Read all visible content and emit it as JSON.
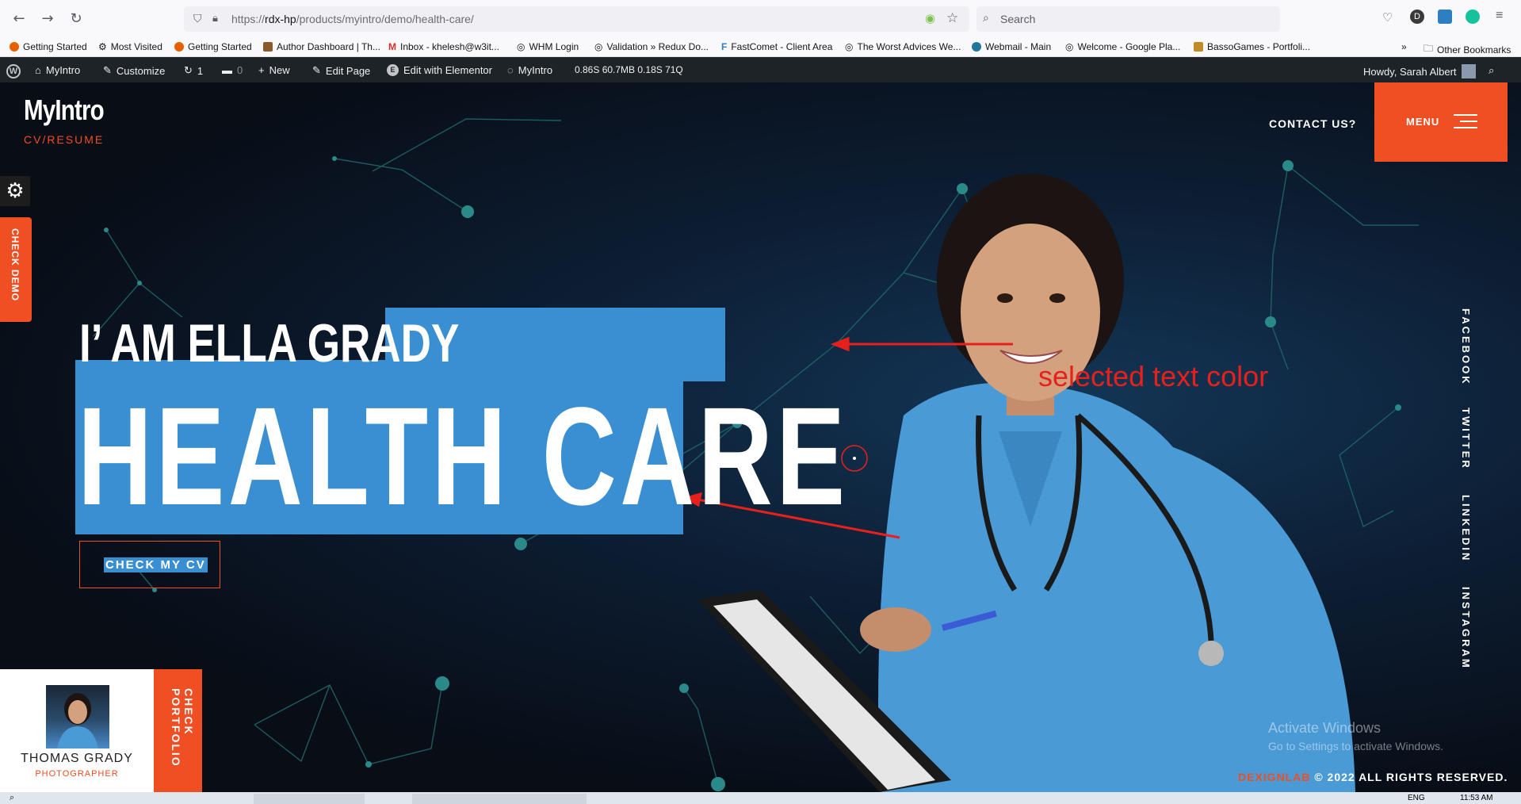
{
  "browser": {
    "url_prefix": "https://",
    "url_host": "rdx-hp",
    "url_path": "/products/myintro/demo/health-care/",
    "search_placeholder": "Search",
    "bookmarks": [
      "Getting Started",
      "Most Visited",
      "Getting Started",
      "Author Dashboard | Th...",
      "Inbox - khelesh@w3it...",
      "WHM Login",
      "Validation » Redux Do...",
      "FastComet - Client Area",
      "The Worst Advices We...",
      "Webmail - Main",
      "Welcome - Google Pla...",
      "BassoGames - Portfoli..."
    ],
    "other_bookmarks": "Other Bookmarks",
    "profile_initial": "D"
  },
  "wp_admin": {
    "site": "MyIntro",
    "customize": "Customize",
    "updates": "1",
    "comments": "0",
    "new": "New",
    "edit_page": "Edit Page",
    "edit_elementor": "Edit with Elementor",
    "theme": "MyIntro",
    "stats": "0.86S 60.7MB 0.18S 71Q",
    "howdy": "Howdy, Sarah Albert"
  },
  "site": {
    "logo_title": "MyIntro",
    "logo_subtitle": "CV/RESUME",
    "contact": "CONTACT US?",
    "menu": "MENU",
    "check_demo": "CHECK DEMO",
    "hero_subtitle": "I’ AM ELLA GRADY",
    "hero_title": "HEALTH CARE",
    "cv_button": "CHECK MY CV",
    "annotation": "selected text color",
    "social": [
      "FACEBOOK",
      "TWITTER",
      "LINKEDIN",
      "INSTAGRAM"
    ],
    "profile_name": "THOMAS GRADY",
    "profile_role": "PHOTOGRAPHER",
    "portfolio_tab": "CHECK PORTFOLIO",
    "footer_brand": "DEXIGNLAB",
    "footer_rights": " © 2022 ALL RIGHTS RESERVED.",
    "watermark_title": "Activate Windows",
    "watermark_sub": "Go to Settings to activate Windows."
  },
  "taskbar": {
    "lang": "ENG",
    "time": "11:53 AM"
  },
  "colors": {
    "accent": "#f04e23",
    "selection": "#3a8fd2",
    "annotation": "#e8201c",
    "wp_bar": "#1d2327"
  }
}
